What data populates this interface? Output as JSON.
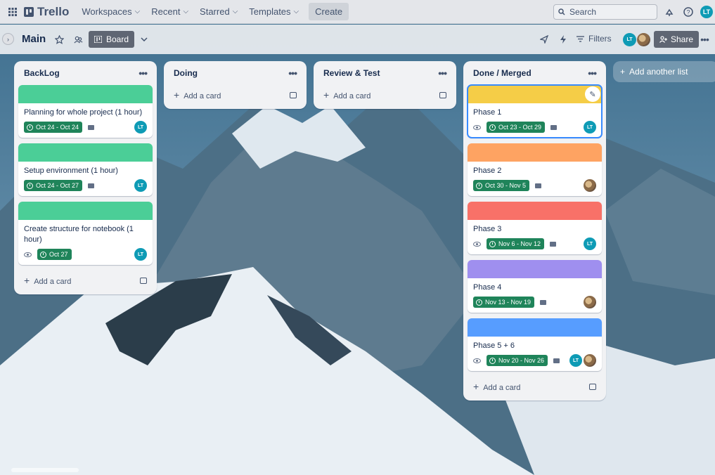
{
  "nav": {
    "logo": "Trello",
    "menus": [
      "Workspaces",
      "Recent",
      "Starred",
      "Templates"
    ],
    "create": "Create",
    "search_placeholder": "Search",
    "user_initials": "LT"
  },
  "board": {
    "title": "Main",
    "view_label": "Board",
    "filters_label": "Filters",
    "share_label": "Share",
    "member_initials": "LT"
  },
  "lists": [
    {
      "title": "BackLog",
      "add_label": "Add a card",
      "cards": [
        {
          "title": "Planning for whole project (1 hour)",
          "cover": "#4bce97",
          "date": "Oct 24 - Oct 24",
          "watch": false,
          "comment": true,
          "members": [
            "LT"
          ]
        },
        {
          "title": "Setup environment (1 hour)",
          "cover": "#4bce97",
          "date": "Oct 24 - Oct 27",
          "watch": false,
          "comment": true,
          "members": [
            "LT"
          ]
        },
        {
          "title": "Create structure for notebook (1 hour)",
          "cover": "#4bce97",
          "date": "Oct 27",
          "watch": true,
          "comment": false,
          "members": [
            "LT"
          ]
        }
      ]
    },
    {
      "title": "Doing",
      "add_label": "Add a card",
      "cards": []
    },
    {
      "title": "Review & Test",
      "add_label": "Add a card",
      "cards": []
    },
    {
      "title": "Done / Merged",
      "add_label": "Add a card",
      "cards": [
        {
          "title": "Phase 1",
          "cover": "#f5cd47",
          "date": "Oct 23 - Oct 29",
          "watch": true,
          "comment": true,
          "members": [
            "LT"
          ]
        },
        {
          "title": "Phase 2",
          "cover": "#fea362",
          "date": "Oct 30 - Nov 5",
          "watch": false,
          "comment": true,
          "members": [
            "photo"
          ]
        },
        {
          "title": "Phase 3",
          "cover": "#f87168",
          "date": "Nov 6 - Nov 12",
          "watch": true,
          "comment": true,
          "members": [
            "LT"
          ]
        },
        {
          "title": "Phase 4",
          "cover": "#9f8fef",
          "date": "Nov 13 - Nov 19",
          "watch": false,
          "comment": true,
          "members": [
            "photo"
          ]
        },
        {
          "title": "Phase 5 + 6",
          "cover": "#579dff",
          "date": "Nov 20 - Nov 26",
          "watch": true,
          "comment": true,
          "members": [
            "LT",
            "photo"
          ]
        }
      ]
    }
  ],
  "add_list_label": "Add another list"
}
